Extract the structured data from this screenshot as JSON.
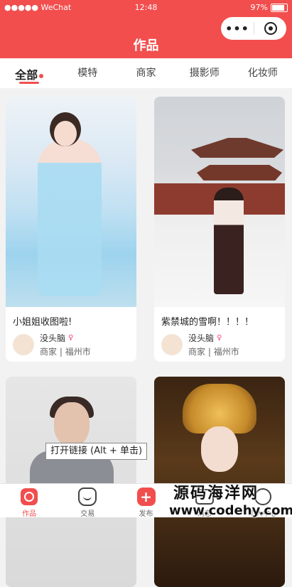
{
  "status_bar": {
    "carrier": "●●●●● WeChat",
    "time": "12:48",
    "battery": "97%",
    "battery_level": 0.97
  },
  "header": {
    "title": "作品",
    "capsule_more": "•••"
  },
  "tabs": [
    {
      "label": "全部",
      "active": true
    },
    {
      "label": "模特",
      "active": false
    },
    {
      "label": "商家",
      "active": false
    },
    {
      "label": "摄影师",
      "active": false
    },
    {
      "label": "化妆师",
      "active": false
    }
  ],
  "works": [
    {
      "caption": "小姐姐收图啦!",
      "author": "没头脑",
      "role": "商家",
      "city": "福州市"
    },
    {
      "caption": "紫禁城的雪啊！！！！",
      "author": "没头脑",
      "role": "商家",
      "city": "福州市"
    },
    {
      "caption": "",
      "author": "",
      "role": "",
      "city": ""
    },
    {
      "caption": "",
      "author": "",
      "role": "",
      "city": ""
    }
  ],
  "tooltip": "打开链接 (Alt + 单击)",
  "tabbar": [
    {
      "label": "作品",
      "icon": "works-icon",
      "active": true
    },
    {
      "label": "交易",
      "icon": "trade-icon",
      "active": false
    },
    {
      "label": "发布",
      "icon": "publish-icon",
      "active": false
    },
    {
      "label": "消息",
      "icon": "message-icon",
      "active": false
    },
    {
      "label": "个人中心",
      "icon": "user-icon",
      "active": false
    }
  ],
  "watermark": {
    "line1": "源码海洋网",
    "line2": "www.codehy.com"
  },
  "colors": {
    "accent": "#f24e4e"
  }
}
